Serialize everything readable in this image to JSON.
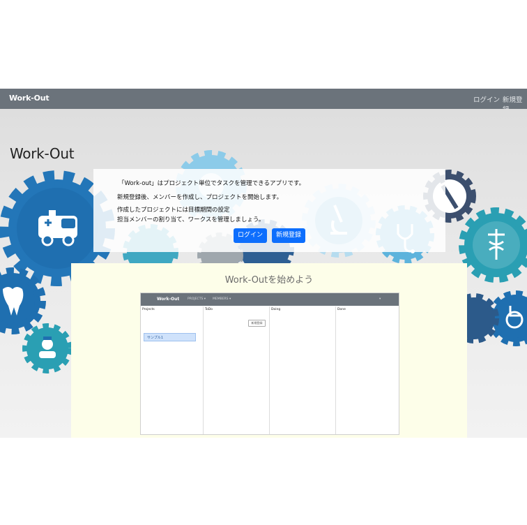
{
  "navbar": {
    "brand": "Work-Out",
    "login": "ログイン",
    "signup": "新規登録"
  },
  "hero": {
    "title": "Work-Out",
    "intro_lines": [
      "「Work-out」はプロジェクト単位でタスクを管理できるアプリです。",
      "新規登録後、メンバーを作成し、プロジェクトを開始します。",
      "作成したプロジェクトには目標期間の設定",
      "担当メンバーの割り当て、ワークスを管理しましょう。"
    ],
    "login_button": "ログイン",
    "signup_button": "新規登録"
  },
  "start": {
    "title": "Work-Outを始めよう",
    "preview": {
      "brand": "Work-Out",
      "menu_projects": "PROJECTS ▾",
      "menu_members": "MEMBERS ▾",
      "menu_right": "▾",
      "columns": [
        "Projects",
        "ToDo",
        "Doing",
        "Done"
      ],
      "new_button": "新規登録",
      "project_item": "サンプル1"
    }
  },
  "colors": {
    "navbar": "#6b737b",
    "primary_button": "#0d6efd",
    "panel_background": "#fdfee9",
    "gear_dark_blue": "#1f5c9e",
    "gear_light_blue": "#7fc1e6",
    "gear_teal": "#2a9fb3"
  },
  "icons": [
    "ambulance-icon",
    "tooth-icon",
    "nurse-icon",
    "microscope-icon",
    "stethoscope-icon",
    "syringe-icon",
    "caduceus-icon",
    "wheelchair-icon"
  ]
}
